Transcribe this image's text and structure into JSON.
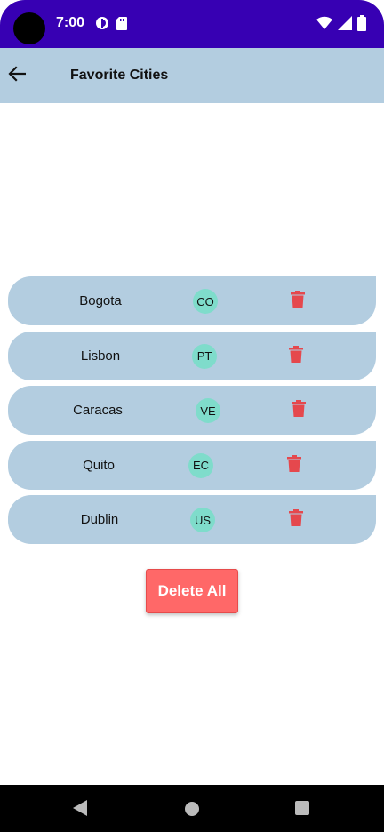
{
  "status_bar": {
    "time": "7:00",
    "icons_left": [
      "assistant-icon",
      "sd-card-icon"
    ],
    "icons_right": [
      "wifi-icon",
      "cell-signal-icon",
      "battery-icon"
    ],
    "color": "#3700b3"
  },
  "app_bar": {
    "title": "Favorite Cities",
    "color": "#b3cde0"
  },
  "cities": [
    {
      "name": "Bogota",
      "country": "CO"
    },
    {
      "name": "Lisbon",
      "country": "PT"
    },
    {
      "name": "Caracas",
      "country": "VE"
    },
    {
      "name": "Quito",
      "country": "EC"
    },
    {
      "name": "Dublin",
      "country": "US"
    }
  ],
  "delete_all": {
    "label": "Delete All",
    "color": "#ff6868"
  },
  "colors": {
    "row": "#b3cde0",
    "badge": "#7fdccb",
    "trash": "#e5484d"
  }
}
